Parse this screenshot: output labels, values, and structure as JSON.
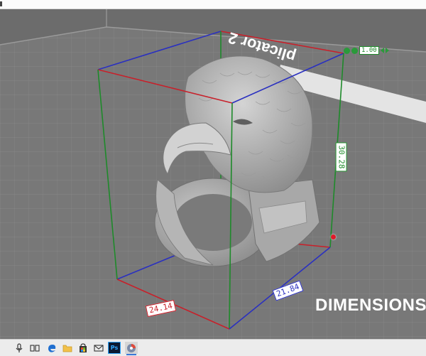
{
  "viewport": {
    "banner_text": "DIMENSIONS",
    "platform_text": "plicator 2",
    "scale_value": "1.00",
    "dimension_x": "24.14",
    "dimension_y": "21.84",
    "dimension_z": "30.28"
  },
  "colors": {
    "axis_x": "#c8202a",
    "axis_y": "#2a30c0",
    "axis_z": "#1e8a2a",
    "model": "#a4a4a4",
    "floor": "#6f6f6f"
  },
  "taskbar": {
    "items": [
      {
        "icon": "microphone-icon"
      },
      {
        "icon": "task-view-icon"
      },
      {
        "icon": "edge-icon"
      },
      {
        "icon": "file-explorer-icon"
      },
      {
        "icon": "store-icon"
      },
      {
        "icon": "mail-icon"
      },
      {
        "icon": "photoshop-icon",
        "label": "Ps"
      },
      {
        "icon": "app-icon"
      }
    ]
  }
}
